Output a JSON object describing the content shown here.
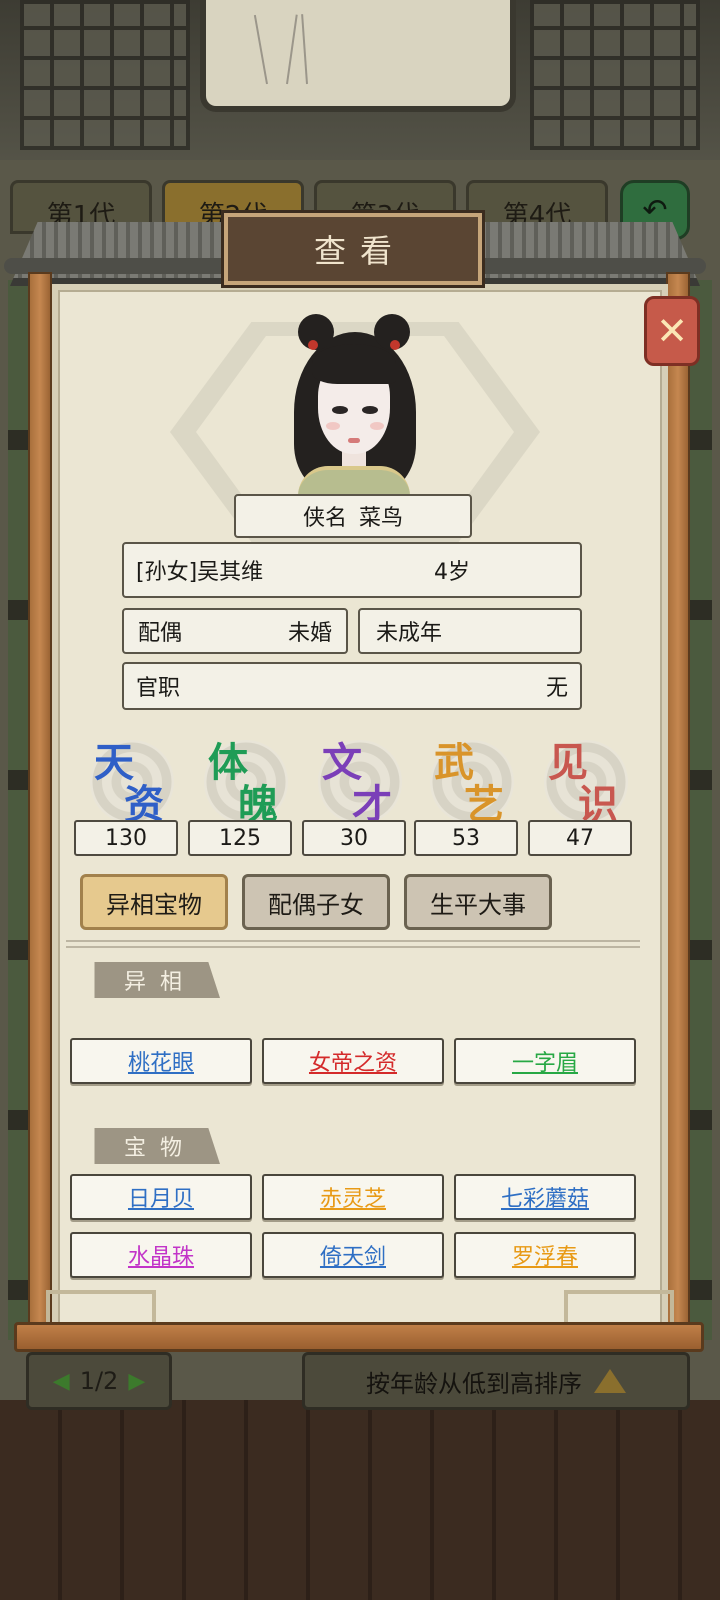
{
  "generation_tabs": [
    "第1代",
    "第2代",
    "第3代",
    "第4代"
  ],
  "dialog_title": "查看",
  "nickname": {
    "label": "侠名",
    "value": "菜鸟"
  },
  "member": {
    "relation_name": "[孙女]吴其维",
    "age": "4岁"
  },
  "spouse": {
    "label": "配偶",
    "value": "未婚"
  },
  "adult_status": "未成年",
  "office": {
    "label": "官职",
    "value": "无"
  },
  "stats": [
    {
      "c1": "天",
      "c2": "资",
      "value": "130",
      "color": "#2f5fc7"
    },
    {
      "c1": "体",
      "c2": "魄",
      "value": "125",
      "color": "#1f9c56"
    },
    {
      "c1": "文",
      "c2": "才",
      "value": "30",
      "color": "#7b3fb8"
    },
    {
      "c1": "武",
      "c2": "艺",
      "value": "53",
      "color": "#d9942a"
    },
    {
      "c1": "见",
      "c2": "识",
      "value": "47",
      "color": "#c8574f"
    }
  ],
  "subtabs": [
    "异相宝物",
    "配偶子女",
    "生平大事"
  ],
  "section_traits": "异相",
  "traits": [
    {
      "label": "桃花眼",
      "color": "#2f6fc4"
    },
    {
      "label": "女帝之资",
      "color": "#d42a2a"
    },
    {
      "label": "一字眉",
      "color": "#27a844"
    }
  ],
  "section_treasures": "宝物",
  "treasures": [
    {
      "label": "日月贝",
      "color": "#2f6fc4"
    },
    {
      "label": "赤灵芝",
      "color": "#e89a16"
    },
    {
      "label": "七彩蘑菇",
      "color": "#2f6fc4"
    },
    {
      "label": "水晶珠",
      "color": "#c234c8"
    },
    {
      "label": "倚天剑",
      "color": "#2f6fc4"
    },
    {
      "label": "罗浮春",
      "color": "#e89a16"
    }
  ],
  "pager": "1/2",
  "sort_label": "按年龄从低到高排序"
}
